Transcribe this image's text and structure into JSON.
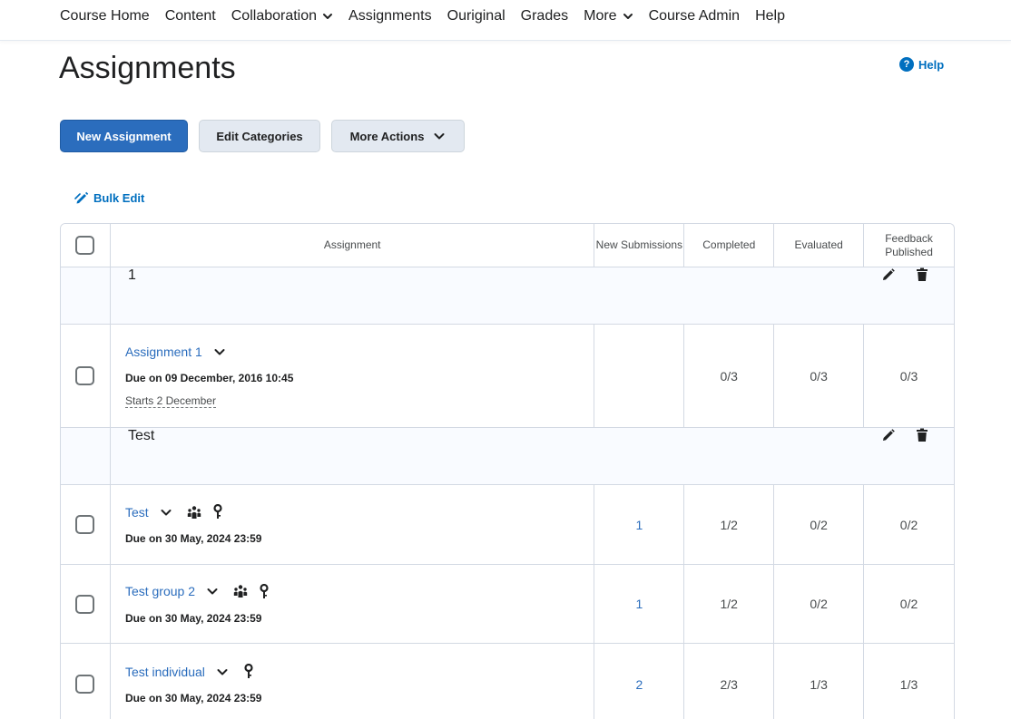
{
  "nav": {
    "items": [
      {
        "label": "Course Home",
        "dropdown": false
      },
      {
        "label": "Content",
        "dropdown": false
      },
      {
        "label": "Collaboration",
        "dropdown": true
      },
      {
        "label": "Assignments",
        "dropdown": false
      },
      {
        "label": "Ouriginal",
        "dropdown": false
      },
      {
        "label": "Grades",
        "dropdown": false
      },
      {
        "label": "More",
        "dropdown": true
      },
      {
        "label": "Course Admin",
        "dropdown": false
      },
      {
        "label": "Help",
        "dropdown": false
      }
    ]
  },
  "page": {
    "title": "Assignments",
    "help_label": "Help"
  },
  "toolbar": {
    "new_assignment": "New Assignment",
    "edit_categories": "Edit Categories",
    "more_actions": "More Actions",
    "bulk_edit": "Bulk Edit"
  },
  "table": {
    "headers": {
      "assignment": "Assignment",
      "new_submissions": "New Submissions",
      "completed": "Completed",
      "evaluated": "Evaluated",
      "feedback_published": "Feedback Published"
    },
    "categories": [
      {
        "label": "1",
        "assignments": [
          {
            "name": "Assignment 1",
            "due": "Due on 09 December, 2016 10:45",
            "starts": "Starts 2 December",
            "group_icon": false,
            "restriction_icon": false,
            "new_submissions": "",
            "completed": "0/3",
            "evaluated": "0/3",
            "feedback_published": "0/3"
          }
        ]
      },
      {
        "label": "Test",
        "assignments": [
          {
            "name": "Test",
            "due": "Due on 30 May, 2024 23:59",
            "group_icon": true,
            "restriction_icon": true,
            "new_submissions": "1",
            "completed": "1/2",
            "evaluated": "0/2",
            "feedback_published": "0/2"
          },
          {
            "name": "Test group 2",
            "due": "Due on 30 May, 2024 23:59",
            "group_icon": true,
            "restriction_icon": true,
            "new_submissions": "1",
            "completed": "1/2",
            "evaluated": "0/2",
            "feedback_published": "0/2"
          },
          {
            "name": "Test individual",
            "due": "Due on 30 May, 2024 23:59",
            "group_icon": false,
            "restriction_icon": true,
            "new_submissions": "2",
            "completed": "2/3",
            "evaluated": "1/3",
            "feedback_published": "1/3"
          }
        ]
      }
    ]
  },
  "icons": {
    "chevron": "chevron-down-icon",
    "help": "help-circle-icon",
    "bulk_edit": "bulk-edit-pencil-icon",
    "edit": "pencil-icon",
    "delete": "trash-icon",
    "group": "group-icon",
    "restriction": "key-icon"
  },
  "colors": {
    "primary": "#2b6dbd",
    "link": "#006fbf",
    "border": "#d3d9e3",
    "category_bg": "#f9fbff"
  }
}
